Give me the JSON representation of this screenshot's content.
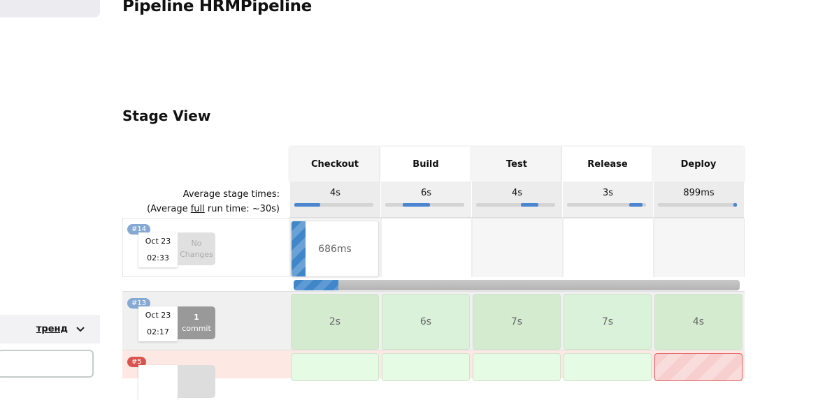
{
  "page": {
    "title": "Pipeline HRMPipeline",
    "stage_view_title": "Stage View"
  },
  "sidebar": {
    "trend_label": "тренд"
  },
  "stage_view": {
    "avg_label": "Average stage times:",
    "avg_full_prefix": "(Average ",
    "avg_full_link": "full",
    "avg_full_suffix": " run time: ~30s)",
    "stages": [
      {
        "name": "Checkout",
        "avg": "4s",
        "bar_start": 0,
        "bar_width": 0.33
      },
      {
        "name": "Build",
        "avg": "6s",
        "bar_start": 0.22,
        "bar_width": 0.35
      },
      {
        "name": "Test",
        "avg": "4s",
        "bar_start": 0.57,
        "bar_width": 0.22
      },
      {
        "name": "Release",
        "avg": "3s",
        "bar_start": 0.79,
        "bar_width": 0.17
      },
      {
        "name": "Deploy",
        "avg": "899ms",
        "bar_start": 0.96,
        "bar_width": 0.04
      }
    ],
    "builds": [
      {
        "id": "#14",
        "date": "Oct 23",
        "time": "02:33",
        "changes": [
          "No",
          "Changes"
        ],
        "cells": [
          "686ms",
          "",
          "",
          "",
          ""
        ],
        "progress": 0.1
      },
      {
        "id": "#13",
        "date": "Oct 23",
        "time": "02:17",
        "changes": [
          "1",
          "commit"
        ],
        "cells": [
          "2s",
          "6s",
          "7s",
          "7s",
          "4s"
        ]
      },
      {
        "id": "#5",
        "date": "",
        "time": "",
        "changes": [
          "",
          ""
        ],
        "cells": [
          "",
          "",
          "",
          "",
          ""
        ]
      }
    ]
  },
  "colors": {
    "blue": "#4d86d0",
    "success": "#d9f0d9",
    "failed_row": "#fde8e4",
    "badge_blue": "#86a9d4",
    "badge_red": "#d9534f"
  }
}
